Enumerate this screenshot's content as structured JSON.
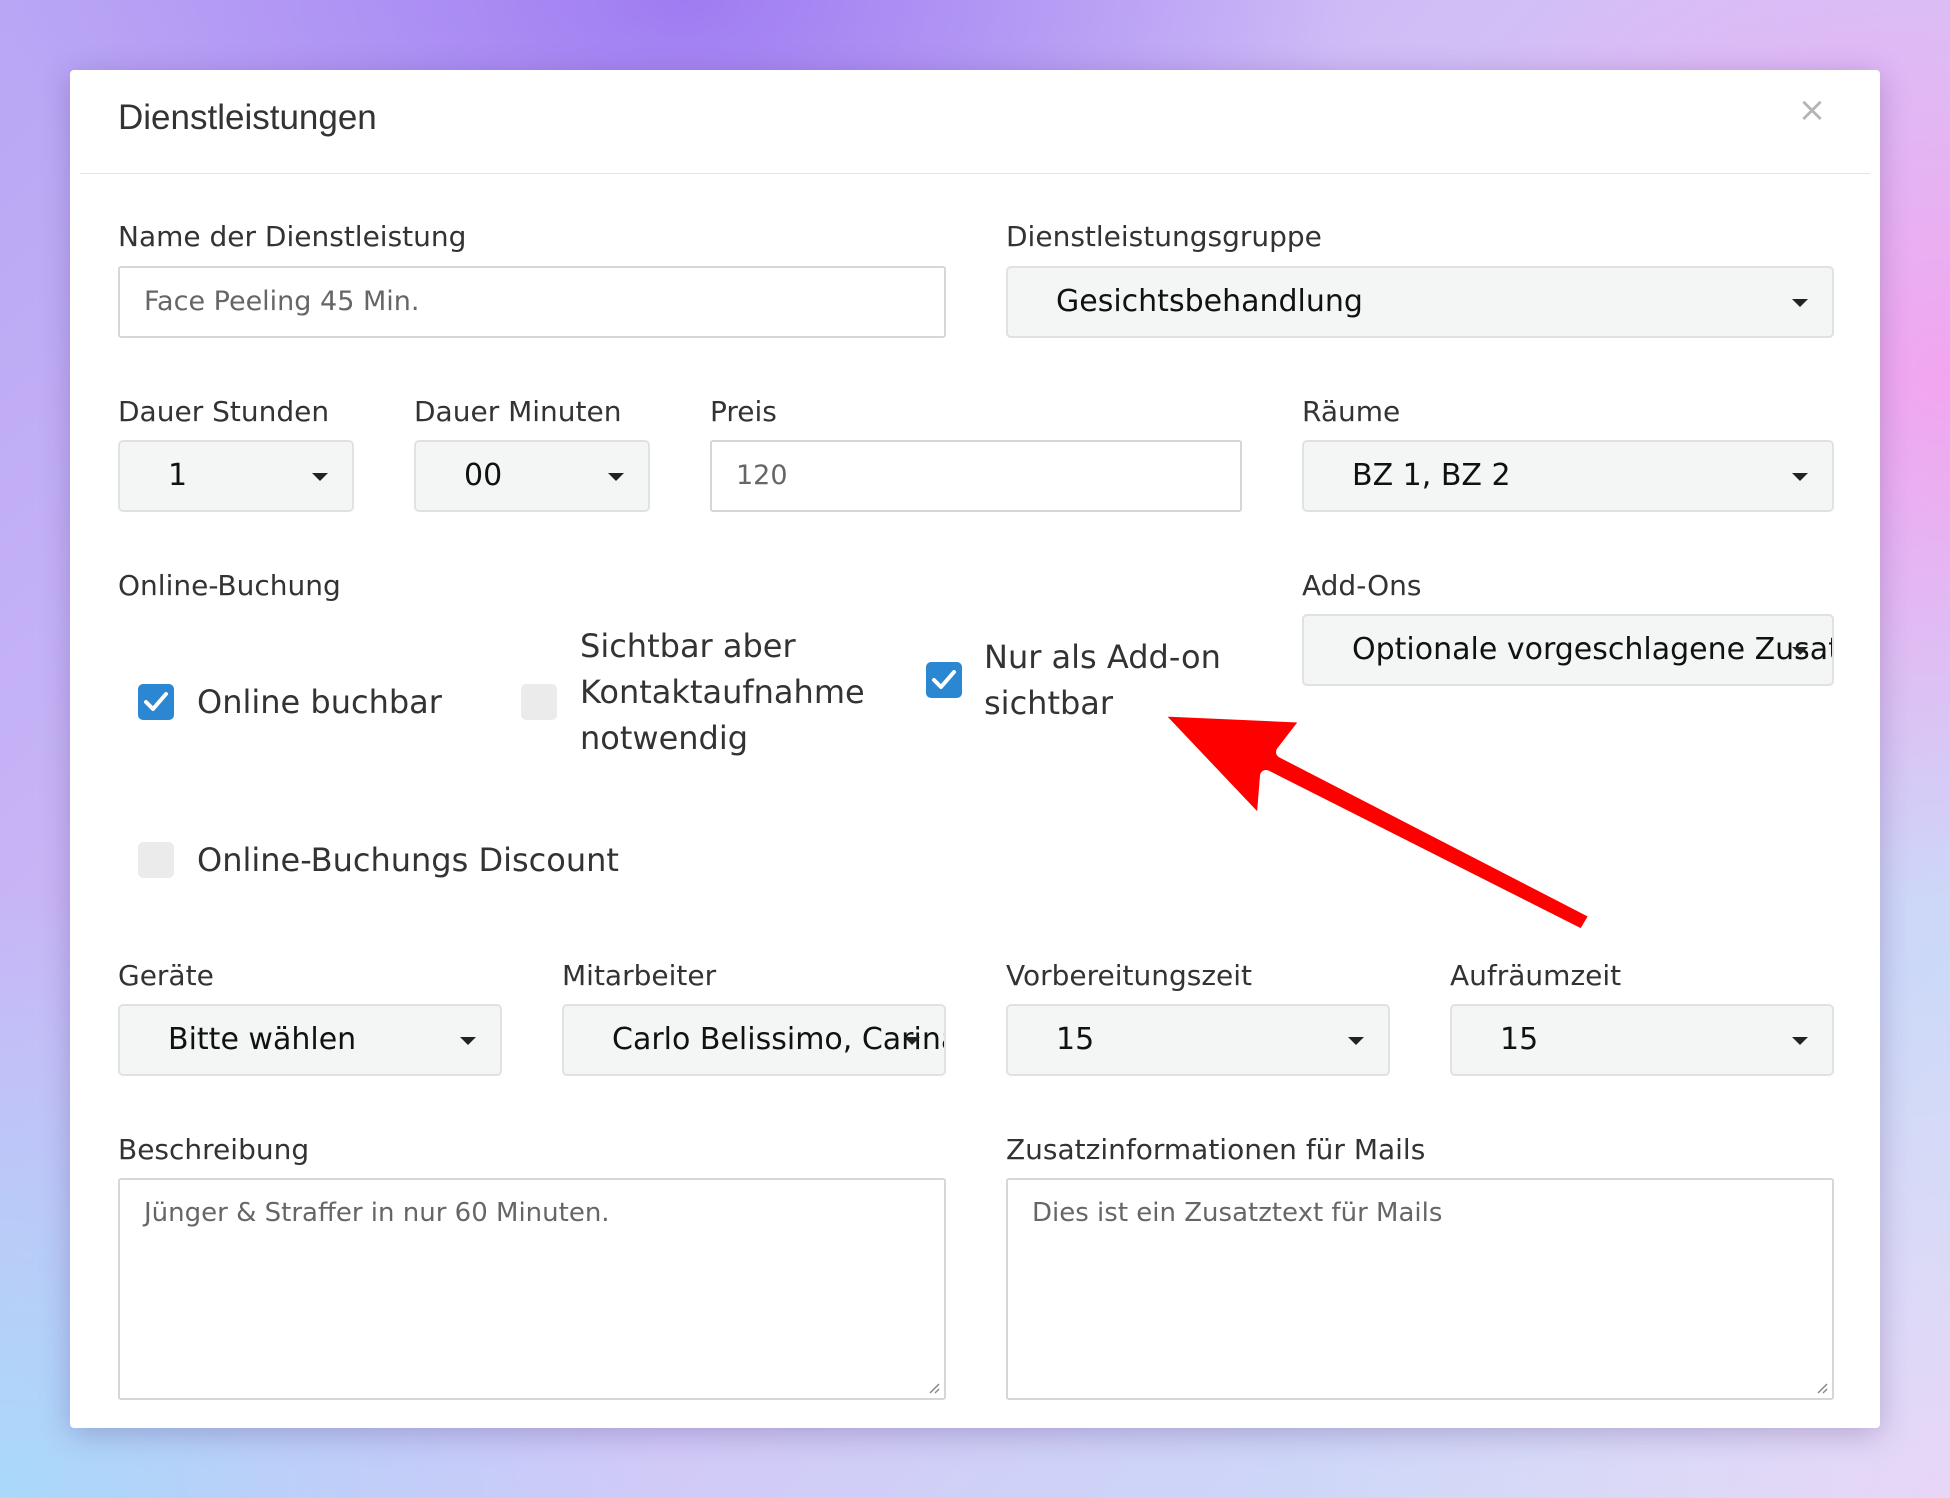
{
  "modal": {
    "title": "Dienstleistungen",
    "close_glyph": "×"
  },
  "fields": {
    "service_name": {
      "label": "Name der Dienstleistung",
      "value": "Face Peeling 45 Min."
    },
    "service_group": {
      "label": "Dienstleistungsgruppe",
      "value": "Gesichtsbehandlung"
    },
    "duration_hours": {
      "label": "Dauer Stunden",
      "value": "1"
    },
    "duration_minutes": {
      "label": "Dauer Minuten",
      "value": "00"
    },
    "price": {
      "label": "Preis",
      "value": "120"
    },
    "rooms": {
      "label": "Räume",
      "value": "BZ 1, BZ 2"
    },
    "addons": {
      "label": "Add-Ons",
      "value": "Optionale vorgeschlagene Zusatzleistungen"
    },
    "devices": {
      "label": "Geräte",
      "value": "Bitte wählen"
    },
    "staff": {
      "label": "Mitarbeiter",
      "value": "Carlo Belissimo, Carina"
    },
    "prep_time": {
      "label": "Vorbereitungszeit",
      "value": "15"
    },
    "cleanup_time": {
      "label": "Aufräumzeit",
      "value": "15"
    },
    "description": {
      "label": "Beschreibung",
      "value": "Jünger & Straffer in nur 60 Minuten."
    },
    "mail_info": {
      "label": "Zusatzinformationen für Mails",
      "value": "Dies ist ein Zusatztext für Mails"
    }
  },
  "online_booking": {
    "label": "Online-Buchung",
    "options": {
      "bookable": {
        "label": "Online buchbar",
        "checked": true
      },
      "visible_contact": {
        "line1": "Sichtbar aber",
        "line2": "Kontaktaufnahme",
        "line3": "notwendig",
        "checked": false
      },
      "addon_only": {
        "line1": "Nur als Add-on",
        "line2": "sichtbar",
        "checked": true
      },
      "discount": {
        "label": "Online-Buchungs Discount",
        "checked": false
      }
    }
  },
  "colors": {
    "checkbox_checked": "#2b87d1",
    "checkbox_unchecked": "#ebebeb",
    "annotation_arrow": "#ff0000"
  },
  "icons": {
    "close": "close-icon",
    "dropdown": "chevron-down-icon",
    "check": "check-icon",
    "annotation": "annotation-arrow-icon"
  }
}
